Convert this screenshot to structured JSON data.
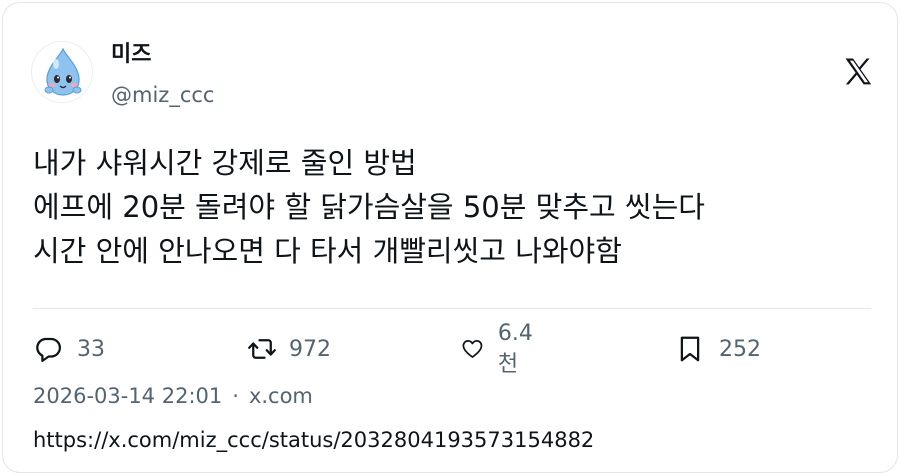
{
  "author": {
    "display_name": "미즈",
    "handle": "@miz_ccc"
  },
  "tweet": {
    "lines": [
      "내가 샤워시간 강제로 줄인 방법",
      "에프에 20분 돌려야 할 닭가슴살을 50분 맞추고 씻는다",
      "시간 안에 안나오면 다 타서 개빨리씻고 나와야함"
    ]
  },
  "actions": {
    "replies": "33",
    "retweets": "972",
    "likes": "6.4천",
    "bookmarks": "252"
  },
  "meta": {
    "timestamp": "2026-03-14 22:01",
    "separator": "·",
    "source": "x.com"
  },
  "url": "https://x.com/miz_ccc/status/2032804193573154882",
  "icons": {
    "platform": "x-logo-icon",
    "reply": "reply-icon",
    "retweet": "retweet-icon",
    "like": "heart-icon",
    "bookmark": "bookmark-icon"
  },
  "colors": {
    "text": "#0f1419",
    "secondary": "#536471",
    "divider": "#e6e6e6",
    "avatar_blue": "#8fc3ef"
  }
}
